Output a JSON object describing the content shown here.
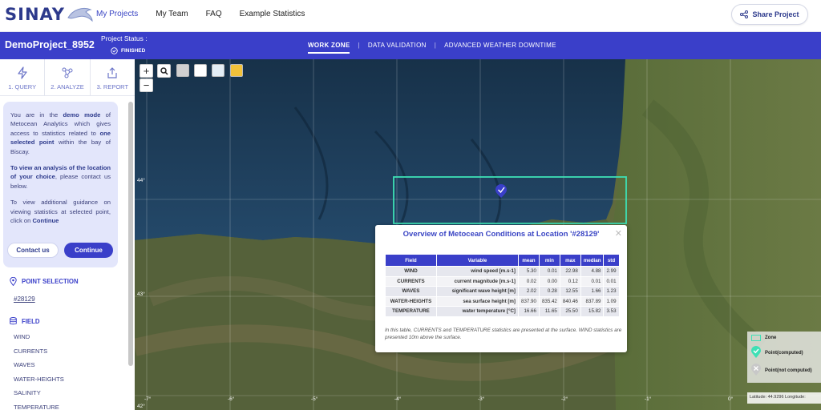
{
  "nav": {
    "logo": "SINAY",
    "links": [
      "My Projects",
      "My Team",
      "FAQ",
      "Example Statistics"
    ],
    "share_label": "Share Project"
  },
  "project": {
    "name": "DemoProject_8952",
    "status_label": "Project Status :",
    "status_value": "FINISHED"
  },
  "zone_tabs": [
    "WORK ZONE",
    "DATA VALIDATION",
    "ADVANCED WEATHER DOWNTIME"
  ],
  "steps": [
    "1. QUERY",
    "2. ANALYZE",
    "3. REPORT"
  ],
  "demo": {
    "p1_a": "You are in the ",
    "p1_b": "demo mode",
    "p1_c": " of Metocean Analytics which gives access to statistics related to ",
    "p1_d": "one selected point",
    "p1_e": " within the bay of Biscay.",
    "p2_a": "To view an analysis of the location of your choice",
    "p2_b": ", please contact us below.",
    "p3_a": "To view additional guidance on viewing statistics at selected point, click on ",
    "p3_b": "Continue",
    "contact_label": "Contact us",
    "continue_label": "Continue"
  },
  "point_selection": {
    "title": "POINT SELECTION",
    "value": "#28129"
  },
  "field": {
    "title": "FIELD",
    "items": [
      "WIND",
      "CURRENTS",
      "WAVES",
      "WATER-HEIGHTS",
      "SALINITY",
      "TEMPERATURE"
    ]
  },
  "map": {
    "lat_labels": [
      "44°",
      "43°",
      "42°"
    ],
    "lon_labels": [
      "-7°",
      "-6°",
      "-5°",
      "-4°",
      "-3°",
      "-2°",
      "-1°",
      "0°"
    ]
  },
  "popup": {
    "title": "Overview of Metocean Conditions at Location '#28129'",
    "headers": [
      "Field",
      "Variable",
      "mean",
      "min",
      "max",
      "median",
      "std"
    ],
    "rows": [
      [
        "WIND",
        "wind speed [m.s-1]",
        "5.30",
        "0.01",
        "22.98",
        "4.88",
        "2.99"
      ],
      [
        "CURRENTS",
        "current magnitude [m.s-1]",
        "0.02",
        "0.00",
        "0.12",
        "0.01",
        "0.01"
      ],
      [
        "WAVES",
        "significant wave height [m]",
        "2.02",
        "0.28",
        "12.55",
        "1.66",
        "1.23"
      ],
      [
        "WATER-HEIGHTS",
        "sea surface height [m]",
        "837.90",
        "835.42",
        "840.46",
        "837.89",
        "1.09"
      ],
      [
        "TEMPERATURE",
        "water temperature [°C]",
        "16.66",
        "11.65",
        "25.50",
        "15.82",
        "3.53"
      ]
    ],
    "note": "In this table, CURRENTS and TEMPERATURE statistics are presented at the surface. WIND statistics are presented 10m above the surface."
  },
  "legend": {
    "zone": "Zone",
    "computed": "Point(computed)",
    "not_computed": "Point(not computed)"
  },
  "coord_readout": "Latitude: 44.9296   Longitude:",
  "colors": {
    "primary": "#3a3fc9",
    "zone": "#3ee0b5",
    "sea": "#1b3a57"
  }
}
